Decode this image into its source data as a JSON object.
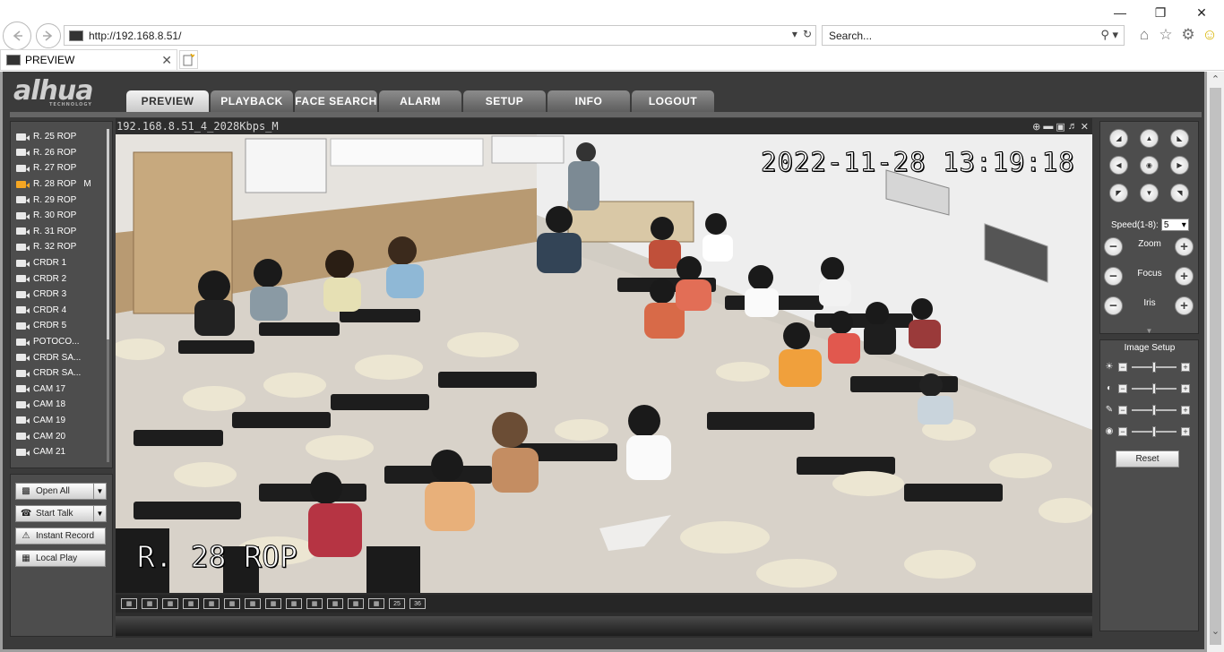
{
  "browser": {
    "url": "http://192.168.8.51/",
    "search_placeholder": "Search...",
    "tab_title": "PREVIEW"
  },
  "app": {
    "logo_text": "alhua",
    "logo_sub": "TECHNOLOGY",
    "menu": [
      "PREVIEW",
      "PLAYBACK",
      "FACE SEARCH",
      "ALARM",
      "SETUP",
      "INFO",
      "LOGOUT"
    ],
    "active_menu": "PREVIEW",
    "cameras": [
      {
        "label": "R. 25 ROP",
        "flag": ""
      },
      {
        "label": "R. 26 ROP",
        "flag": ""
      },
      {
        "label": "R. 27 ROP",
        "flag": ""
      },
      {
        "label": "R. 28 ROP",
        "flag": "M"
      },
      {
        "label": "R. 29 ROP",
        "flag": ""
      },
      {
        "label": "R. 30 ROP",
        "flag": ""
      },
      {
        "label": "R. 31 ROP",
        "flag": ""
      },
      {
        "label": "R. 32 ROP",
        "flag": ""
      },
      {
        "label": "CRDR 1",
        "flag": ""
      },
      {
        "label": "CRDR 2",
        "flag": ""
      },
      {
        "label": "CRDR 3",
        "flag": ""
      },
      {
        "label": "CRDR 4",
        "flag": ""
      },
      {
        "label": "CRDR 5",
        "flag": ""
      },
      {
        "label": "POTOCO...",
        "flag": ""
      },
      {
        "label": "CRDR SA...",
        "flag": ""
      },
      {
        "label": "CRDR SA...",
        "flag": ""
      },
      {
        "label": "CAM 17",
        "flag": ""
      },
      {
        "label": "CAM 18",
        "flag": ""
      },
      {
        "label": "CAM 19",
        "flag": ""
      },
      {
        "label": "CAM 20",
        "flag": ""
      },
      {
        "label": "CAM 21",
        "flag": ""
      }
    ],
    "actions": {
      "open_all": "Open All",
      "start_talk": "Start Talk",
      "instant_record": "Instant Record",
      "local_play": "Local Play"
    },
    "video": {
      "caption": "192.168.8.51_4_2028Kbps_M",
      "osd_timestamp": "2022-11-28  13:19:18",
      "osd_channel": "R. 28 ROP"
    },
    "split_buttons": [
      "",
      "",
      "",
      "",
      "",
      "",
      "",
      "",
      "",
      "",
      "",
      "",
      "",
      "25",
      "36"
    ],
    "ptz": {
      "speed_label": "Speed(1-8):",
      "speed_value": "5",
      "zoom": "Zoom",
      "focus": "Focus",
      "iris": "Iris"
    },
    "image_setup": {
      "title": "Image Setup",
      "reset": "Reset",
      "levels": [
        0.5,
        0.5,
        0.5,
        0.5
      ]
    }
  }
}
